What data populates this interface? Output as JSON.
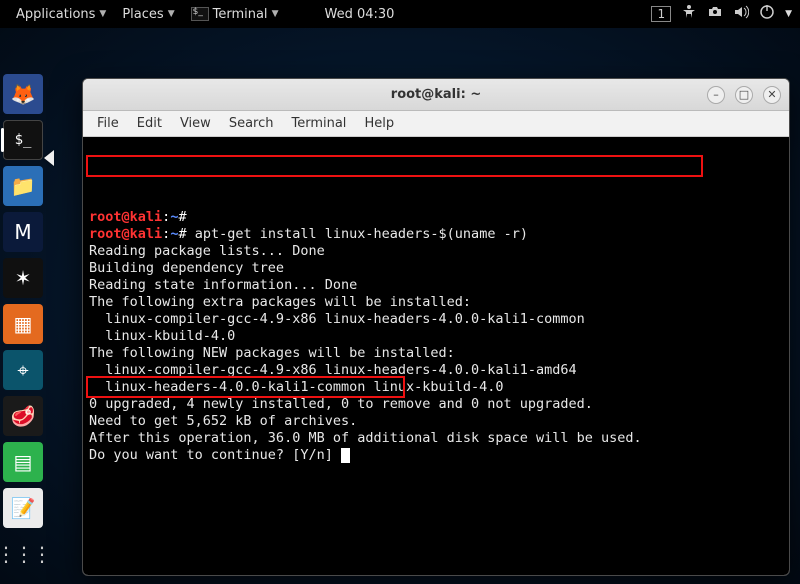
{
  "top_panel": {
    "applications": "Applications",
    "places": "Places",
    "terminal": "Terminal",
    "clock": "Wed 04:30",
    "workspace_badge": "1"
  },
  "dock": {
    "items": [
      {
        "name": "iceweasel",
        "glyph": "🦊",
        "bg": "#2b4b8f"
      },
      {
        "name": "terminal",
        "glyph": "$_",
        "bg": "#111",
        "active": true
      },
      {
        "name": "files",
        "glyph": "📁",
        "bg": "#2b6fb7"
      },
      {
        "name": "metasploit",
        "glyph": "M",
        "bg": "#0b1a3a"
      },
      {
        "name": "armitage",
        "glyph": "✶",
        "bg": "#101010"
      },
      {
        "name": "burp",
        "glyph": "▦",
        "bg": "#e46a1f"
      },
      {
        "name": "maltego",
        "glyph": "⌖",
        "bg": "#0b546b"
      },
      {
        "name": "beef",
        "glyph": "🥩",
        "bg": "#1a1a1a"
      },
      {
        "name": "faraday",
        "glyph": "▤",
        "bg": "#2db24d"
      },
      {
        "name": "leafpad",
        "glyph": "📝",
        "bg": "#ececec"
      },
      {
        "name": "show-apps",
        "glyph": "⋮⋮⋮",
        "bg": "transparent"
      }
    ]
  },
  "window": {
    "title": "root@kali: ~",
    "menus": [
      "File",
      "Edit",
      "View",
      "Search",
      "Terminal",
      "Help"
    ]
  },
  "terminal": {
    "user": "root",
    "host": "kali",
    "path": "~",
    "prompt_symbol": "#",
    "command": "apt-get install linux-headers-$(uname -r)",
    "lines": [
      "Reading package lists... Done",
      "Building dependency tree",
      "Reading state information... Done",
      "The following extra packages will be installed:",
      "  linux-compiler-gcc-4.9-x86 linux-headers-4.0.0-kali1-common",
      "  linux-kbuild-4.0",
      "The following NEW packages will be installed:",
      "  linux-compiler-gcc-4.9-x86 linux-headers-4.0.0-kali1-amd64",
      "  linux-headers-4.0.0-kali1-common linux-kbuild-4.0",
      "0 upgraded, 4 newly installed, 0 to remove and 0 not upgraded.",
      "Need to get 5,652 kB of archives.",
      "After this operation, 36.0 MB of additional disk space will be used.",
      "Do you want to continue? [Y/n] "
    ]
  }
}
